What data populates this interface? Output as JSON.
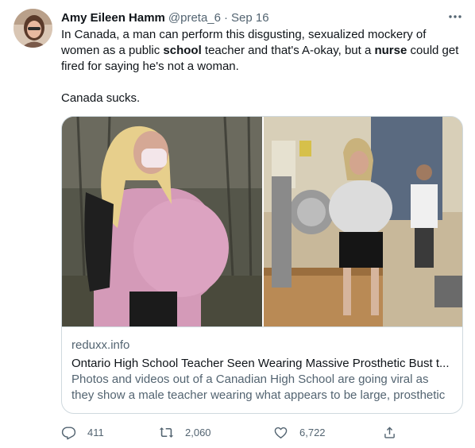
{
  "author": {
    "display_name": "Amy Eileen Hamm",
    "handle": "@preta_6",
    "separator": "·",
    "date": "Sep 16"
  },
  "tweet": {
    "line1_pre": "In Canada, a man can perform this disgusting, sexualized mockery of women as a public ",
    "line1_bold": "school",
    "line1_mid": " teacher and that's A-okay, but a ",
    "line1_bold2": "nurse",
    "line1_post": " could get fired for saying he's not a woman.",
    "line2": "Canada sucks."
  },
  "card": {
    "domain": "reduxx.info",
    "title": "Ontario High School Teacher Seen Wearing Massive Prosthetic Bust t...",
    "description": "Photos and videos out of a Canadian High School are going viral as they show a male teacher wearing what appears to be large, prosthetic ..."
  },
  "actions": {
    "replies": "411",
    "retweets": "2,060",
    "likes": "6,722"
  },
  "icons": {
    "more": "more-icon",
    "reply": "reply-icon",
    "retweet": "retweet-icon",
    "like": "like-icon",
    "share": "share-icon"
  },
  "colors": {
    "text": "#0f1419",
    "secondary": "#536471",
    "border": "#cfd9de"
  }
}
